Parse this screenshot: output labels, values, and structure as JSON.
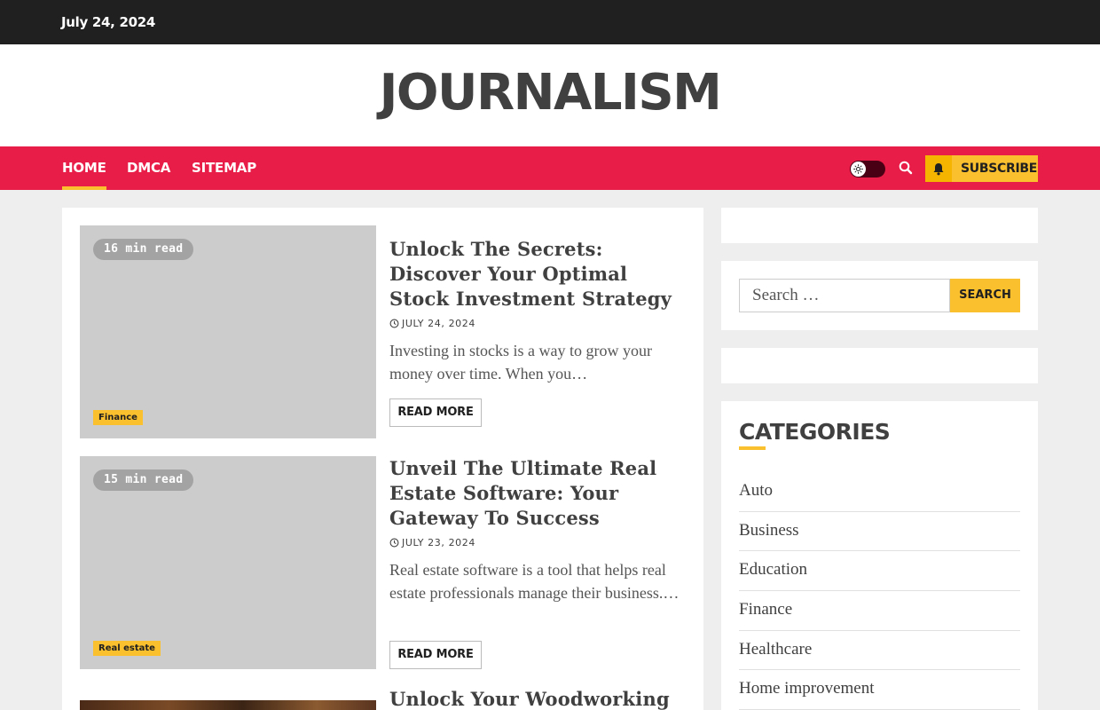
{
  "topbar": {
    "date": "July 24, 2024"
  },
  "site": {
    "title": "JOURNALISM"
  },
  "nav": {
    "items": [
      {
        "label": "HOME",
        "active": true
      },
      {
        "label": "DMCA",
        "active": false
      },
      {
        "label": "SITEMAP",
        "active": false
      }
    ],
    "subscribe_label": "SUBSCRIBE"
  },
  "posts": [
    {
      "read_time": "16 min read",
      "category": "Finance",
      "title": "Unlock The Secrets: Discover Your Optimal Stock Investment Strategy",
      "date": "JULY 24, 2024",
      "excerpt": "Investing in stocks is a way to grow your money over time. When you…",
      "read_more": "READ MORE"
    },
    {
      "read_time": "15 min read",
      "category": "Real estate",
      "title": "Unveil The Ultimate Real Estate Software: Your Gateway To Success",
      "date": "JULY 23, 2024",
      "excerpt": "Real estate software is a tool that helps real estate professionals manage their business.…",
      "read_more": "READ MORE"
    },
    {
      "title": "Unlock Your Woodworking"
    }
  ],
  "sidebar": {
    "search": {
      "placeholder": "Search …",
      "button_label": "SEARCH"
    },
    "categories": {
      "heading": "CATEGORIES",
      "items": [
        "Auto",
        "Business",
        "Education",
        "Finance",
        "Healthcare",
        "Home improvement"
      ]
    }
  },
  "colors": {
    "nav_background": "#e91e48",
    "accent_yellow": "#fbc02d",
    "topbar": "#202020"
  }
}
